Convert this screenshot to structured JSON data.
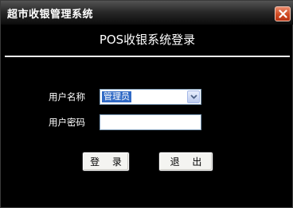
{
  "window": {
    "title": "超市收银管理系统",
    "close_icon": "close-icon"
  },
  "header": {
    "title": "POS收银系统登录"
  },
  "form": {
    "username_label": "用户名称",
    "username_value": "管理员",
    "password_label": "用户密码",
    "password_value": ""
  },
  "buttons": {
    "login_label": "登 录",
    "exit_label": "退 出"
  },
  "colors": {
    "background": "#000000",
    "selection": "#316ac5",
    "close_button": "#d04a22"
  }
}
